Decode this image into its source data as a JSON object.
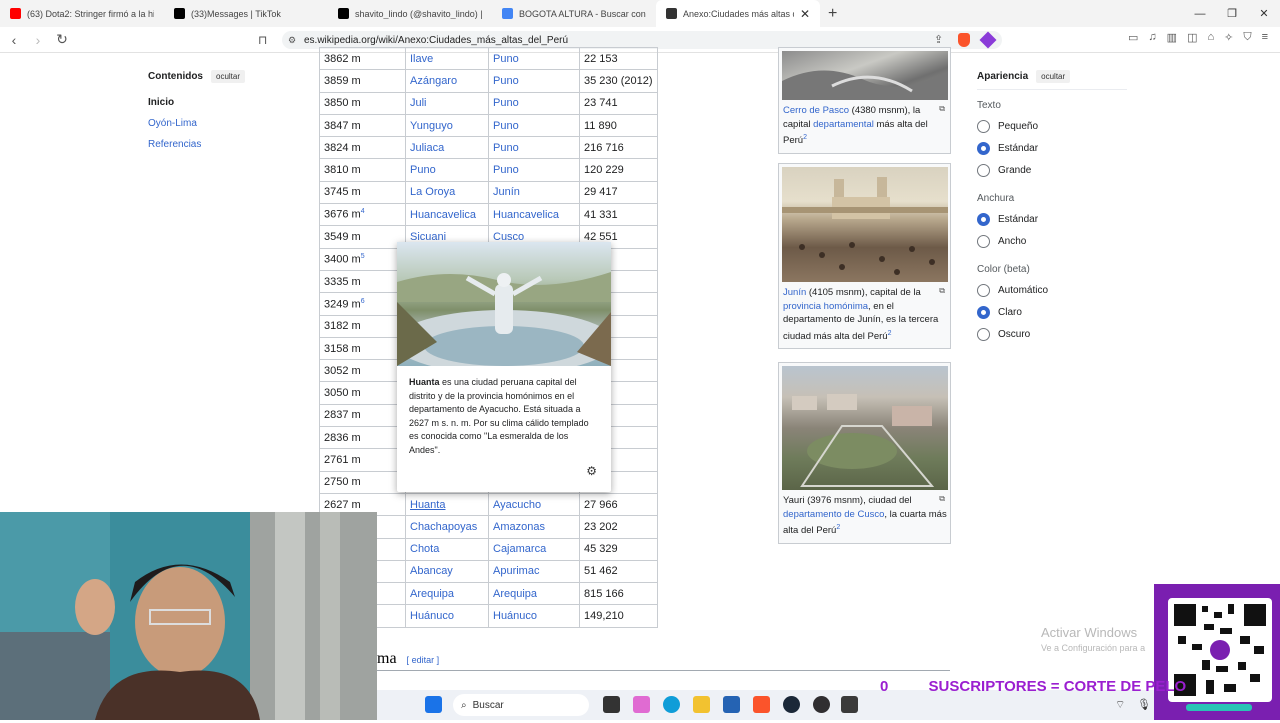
{
  "browser": {
    "tabs": [
      {
        "title": "(63) Dota2: Stringer firmó a la hija de",
        "icon": "youtube-icon",
        "color": "#ff0000"
      },
      {
        "title": "(33)Messages | TikTok",
        "icon": "tiktok-icon",
        "color": "#000000"
      },
      {
        "title": "shavito_lindo (@shavito_lindo) | TikTo",
        "icon": "tiktok-icon",
        "color": "#000000"
      },
      {
        "title": "BOGOTA ALTURA - Buscar con Goog",
        "icon": "google-icon",
        "color": "#4285f4"
      },
      {
        "title": "Anexo:Ciudades más altas del Pe",
        "icon": "wikipedia-icon",
        "color": "#333333"
      }
    ],
    "url": "es.wikipedia.org/wiki/Anexo:Ciudades_más_altas_del_Perú"
  },
  "toc": {
    "title": "Contenidos",
    "hide": "ocultar",
    "items": [
      "Inicio",
      "Oyón-Lima",
      "Referencias"
    ]
  },
  "table": {
    "rows": [
      {
        "alt": "3862 m",
        "sup": "",
        "city": "Ilave",
        "dept": "Puno",
        "pop": "22 153"
      },
      {
        "alt": "3859 m",
        "sup": "",
        "city": "Azángaro",
        "dept": "Puno",
        "pop": "35 230 (2012)"
      },
      {
        "alt": "3850 m",
        "sup": "",
        "city": "Juli",
        "dept": "Puno",
        "pop": "23 741"
      },
      {
        "alt": "3847 m",
        "sup": "",
        "city": "Yunguyo",
        "dept": "Puno",
        "pop": "11 890"
      },
      {
        "alt": "3824 m",
        "sup": "",
        "city": "Juliaca",
        "dept": "Puno",
        "pop": "216 716"
      },
      {
        "alt": "3810 m",
        "sup": "",
        "city": "Puno",
        "dept": "Puno",
        "pop": "120 229"
      },
      {
        "alt": "3745 m",
        "sup": "",
        "city": "La Oroya",
        "dept": "Junín",
        "pop": "29 417"
      },
      {
        "alt": "3676 m",
        "sup": "4",
        "city": "Huancavelica",
        "dept": "Huancavelica",
        "pop": "41 331"
      },
      {
        "alt": "3549 m",
        "sup": "",
        "city": "Sicuani",
        "dept": "Cusco",
        "pop": "42 551"
      },
      {
        "alt": "3400 m",
        "sup": "5",
        "city": "",
        "dept": "",
        "pop": "35"
      },
      {
        "alt": "3335 m",
        "sup": "",
        "city": "",
        "dept": "",
        "pop": "4"
      },
      {
        "alt": "3249 m",
        "sup": "6",
        "city": "",
        "dept": "",
        "pop": "54"
      },
      {
        "alt": "3182 m",
        "sup": "",
        "city": "",
        "dept": "",
        "pop": "0"
      },
      {
        "alt": "3158 m",
        "sup": "",
        "city": "",
        "dept": "",
        "pop": "4"
      },
      {
        "alt": "3052 m",
        "sup": "",
        "city": "",
        "dept": "",
        "pop": "31"
      },
      {
        "alt": "3050 m",
        "sup": "",
        "city": "",
        "dept": "",
        "pop": "9"
      },
      {
        "alt": "2837 m",
        "sup": "",
        "city": "",
        "dept": "",
        "pop": ""
      },
      {
        "alt": "2836 m",
        "sup": "",
        "city": "",
        "dept": "",
        "pop": "0"
      },
      {
        "alt": "2761 m",
        "sup": "",
        "city": "",
        "dept": "",
        "pop": "19"
      },
      {
        "alt": "2750 m",
        "sup": "",
        "city": "",
        "dept": "",
        "pop": "29"
      },
      {
        "alt": "2627 m",
        "sup": "",
        "city": "Huanta",
        "dept": "Ayacucho",
        "pop": "27 966"
      },
      {
        "alt": "",
        "sup": "",
        "city": "Chachapoyas",
        "dept": "Amazonas",
        "pop": "23 202"
      },
      {
        "alt": "",
        "sup": "",
        "city": "Chota",
        "dept": "Cajamarca",
        "pop": "45 329"
      },
      {
        "alt": "",
        "sup": "",
        "city": "Abancay",
        "dept": "Apurimac",
        "pop": "51 462"
      },
      {
        "alt": "",
        "sup": "",
        "city": "Arequipa",
        "dept": "Arequipa",
        "pop": "815 166"
      },
      {
        "alt": "",
        "sup": "",
        "city": "Huánuco",
        "dept": "Huánuco",
        "pop": "149,210"
      }
    ]
  },
  "section": {
    "title": "ma",
    "edit": "editar"
  },
  "popup": {
    "bold": "Huanta",
    "text": " es una ciudad peruana capital del distrito y de la provincia homónimos en el departamento de Ayacucho. Está situada a 2627 m s. n. m. Por su clima cálido templado es conocida como \"La esmeralda de los Andes\"."
  },
  "thumbs": {
    "t1": {
      "link1": "Cerro de Pasco",
      "t1": " (4380 msnm), la capital ",
      "link2": "departamental",
      "t2": " más alta del Perú",
      "sup": "2"
    },
    "t2": {
      "link1": "Junín",
      "t1": " (4105 msnm), capital de la ",
      "link2": "provincia homónima",
      "t2": ", en el departamento de Junín, es la tercera ciudad más alta del Perú",
      "sup": "2"
    },
    "t3": {
      "t0": "Yauri (3976 msnm), ciudad del ",
      "link1": "departamento de Cusco",
      "t1": ", la cuarta más alta del Perú",
      "sup": "2"
    }
  },
  "appearance": {
    "title": "Apariencia",
    "hide": "ocultar",
    "text_label": "Texto",
    "text_opts": [
      "Pequeño",
      "Estándar",
      "Grande"
    ],
    "text_selected": 1,
    "width_label": "Anchura",
    "width_opts": [
      "Estándar",
      "Ancho"
    ],
    "width_selected": 0,
    "color_label": "Color (beta)",
    "color_opts": [
      "Automático",
      "Claro",
      "Oscuro"
    ],
    "color_selected": 1
  },
  "taskbar": {
    "search": "Buscar"
  },
  "watermark": {
    "line1": "Activar Windows",
    "line2": "Ve a Configuración para a"
  },
  "overlay": {
    "count": "0",
    "text": "SUSCRIPTORES = CORTE DE PELO"
  }
}
